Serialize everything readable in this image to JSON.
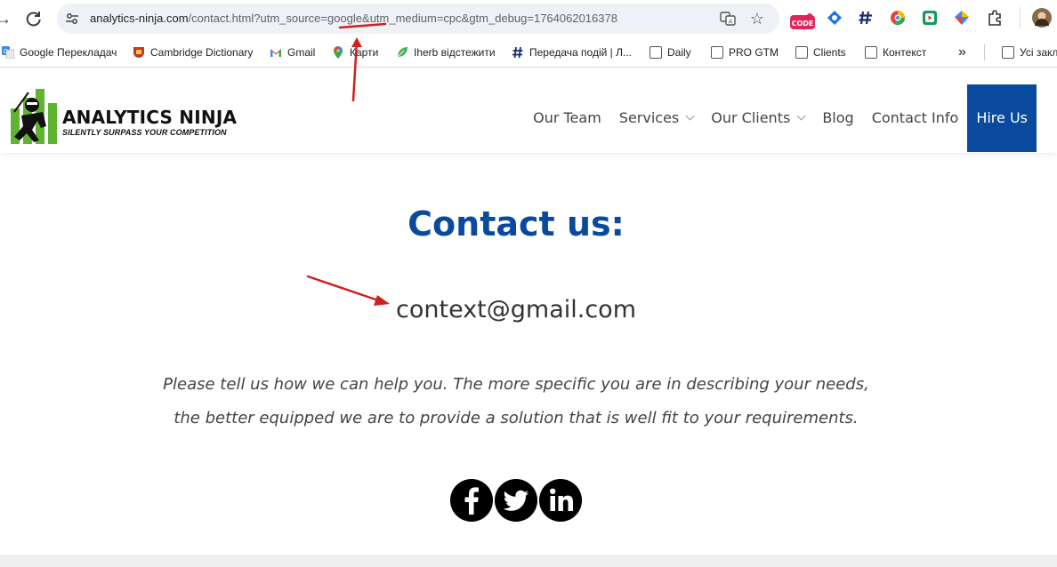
{
  "browser": {
    "url_host": "analytics-ninja.com",
    "url_path": "/contact.html?utm_source=google&utm_medium=cpc&gtm_debug=1764062016378",
    "extension_code_label": "CODE",
    "bookmarks": [
      {
        "label": "Google Перекладач",
        "icon": "google-translate-icon"
      },
      {
        "label": "Cambridge Dictionary",
        "icon": "cambridge-icon"
      },
      {
        "label": "Gmail",
        "icon": "gmail-icon"
      },
      {
        "label": "Карти",
        "icon": "maps-icon"
      },
      {
        "label": "Iherb відстежити",
        "icon": "iherb-icon"
      },
      {
        "label": "Передача подій | Л...",
        "icon": "hash-icon"
      },
      {
        "label": "Daily",
        "icon": "folder-icon"
      },
      {
        "label": "PRO GTM",
        "icon": "folder-icon"
      },
      {
        "label": "Clients",
        "icon": "folder-icon"
      },
      {
        "label": "Контекст",
        "icon": "folder-icon"
      },
      {
        "label": "Усі закл",
        "icon": "folder-icon"
      }
    ]
  },
  "site": {
    "logo_title": "ANALYTICS NINJA",
    "logo_subtitle": "SILENTLY SURPASS YOUR COMPETITION",
    "nav": [
      {
        "label": "Our Team",
        "has_dropdown": false
      },
      {
        "label": "Services",
        "has_dropdown": true
      },
      {
        "label": "Our Clients",
        "has_dropdown": true
      },
      {
        "label": "Blog",
        "has_dropdown": false
      },
      {
        "label": "Contact Info",
        "has_dropdown": false
      }
    ],
    "cta_label": "Hire Us",
    "accent_color": "#0a4a9e"
  },
  "content": {
    "heading": "Contact us:",
    "email": "context@gmail.com",
    "description_line1": "Please tell us how we can help you. The more specific you are in describing your needs,",
    "description_line2": "the better equipped we are to provide a solution that is well fit to your requirements.",
    "social": [
      "facebook-icon",
      "twitter-icon",
      "linkedin-icon"
    ]
  },
  "annotation_color": "#d21f1f"
}
